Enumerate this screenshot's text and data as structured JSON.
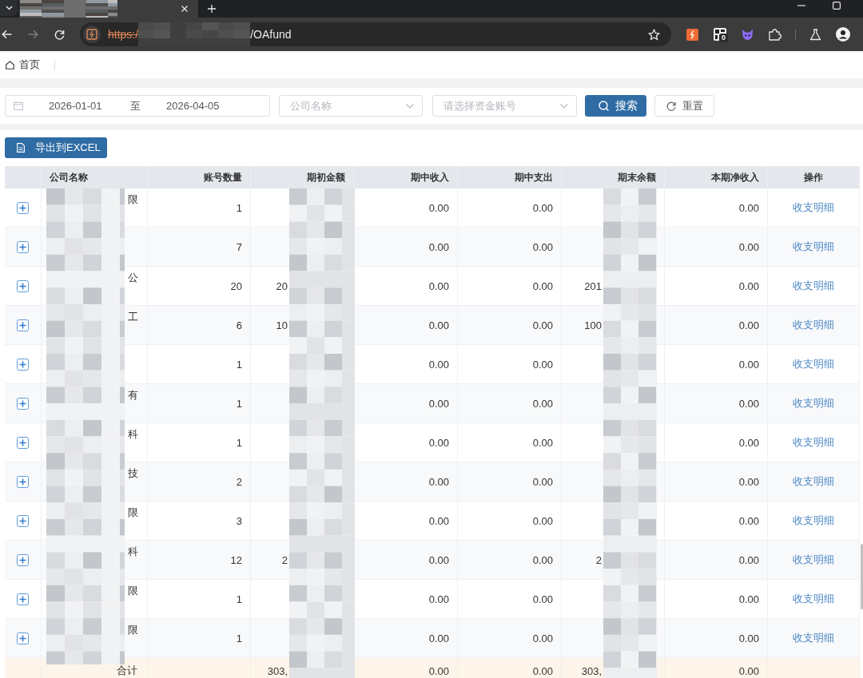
{
  "browser": {
    "url": {
      "scheme": "https:/",
      "path": "/OAfund",
      "not_secure": true
    },
    "extension_badge": "0"
  },
  "nav": {
    "home_tab": {
      "label": "首页"
    }
  },
  "filters": {
    "date_range": {
      "start": "2026-01-01",
      "separator": "至",
      "end": "2026-04-05"
    },
    "company_select": {
      "placeholder": "公司名称"
    },
    "account_select": {
      "placeholder": "请选择资金账号"
    },
    "buttons": [
      {
        "kind": "search",
        "label": "搜索"
      },
      {
        "kind": "reset",
        "label": "重置"
      }
    ]
  },
  "export_button": {
    "label": "导出到EXCEL"
  },
  "table": {
    "columns": [
      "公司名称",
      "账号数量",
      "期初金额",
      "期中收入",
      "期中支出",
      "期末余额",
      "本期净收入",
      "操作"
    ],
    "rows": [
      {
        "expanded": false,
        "company": "限",
        "accounts": "1",
        "income": "0.00",
        "expense": "0.00",
        "net": "0.00",
        "action": "收支明细"
      },
      {
        "expanded": false,
        "accounts": "7",
        "income": "0.00",
        "expense": "0.00",
        "net": "0.00",
        "action": "收支明细"
      },
      {
        "expanded": false,
        "company": "公",
        "accounts": "20",
        "opening": "20",
        "income": "0.00",
        "expense": "0.00",
        "ending": "201",
        "net": "0.00",
        "action": "收支明细"
      },
      {
        "expanded": false,
        "company": "工",
        "accounts": "6",
        "opening": "10",
        "income": "0.00",
        "expense": "0.00",
        "ending": "100",
        "net": "0.00",
        "action": "收支明细"
      },
      {
        "expanded": false,
        "accounts": "1",
        "income": "0.00",
        "expense": "0.00",
        "net": "0.00",
        "action": "收支明细"
      },
      {
        "expanded": false,
        "company": "有",
        "accounts": "1",
        "income": "0.00",
        "expense": "0.00",
        "net": "0.00",
        "action": "收支明细"
      },
      {
        "expanded": false,
        "company": "科",
        "accounts": "1",
        "income": "0.00",
        "expense": "0.00",
        "net": "0.00",
        "action": "收支明细"
      },
      {
        "expanded": false,
        "company": "技",
        "accounts": "2",
        "income": "0.00",
        "expense": "0.00",
        "net": "0.00",
        "action": "收支明细"
      },
      {
        "expanded": false,
        "company": "限",
        "accounts": "3",
        "income": "0.00",
        "expense": "0.00",
        "net": "0.00",
        "action": "收支明细"
      },
      {
        "expanded": false,
        "company": "科",
        "accounts": "12",
        "opening": "2",
        "income": "0.00",
        "expense": "0.00",
        "ending": "2",
        "net": "0.00",
        "action": "收支明细"
      },
      {
        "expanded": false,
        "company": "限",
        "accounts": "1",
        "income": "0.00",
        "expense": "0.00",
        "net": "0.00",
        "action": "收支明细"
      },
      {
        "expanded": false,
        "company": "限",
        "accounts": "1",
        "income": "0.00",
        "expense": "0.00",
        "net": "0.00",
        "action": "收支明细"
      }
    ],
    "total": {
      "label": "合计",
      "opening": "303,",
      "income": "0.00",
      "expense": "0.00",
      "ending": "303,",
      "net": "0.00"
    }
  }
}
